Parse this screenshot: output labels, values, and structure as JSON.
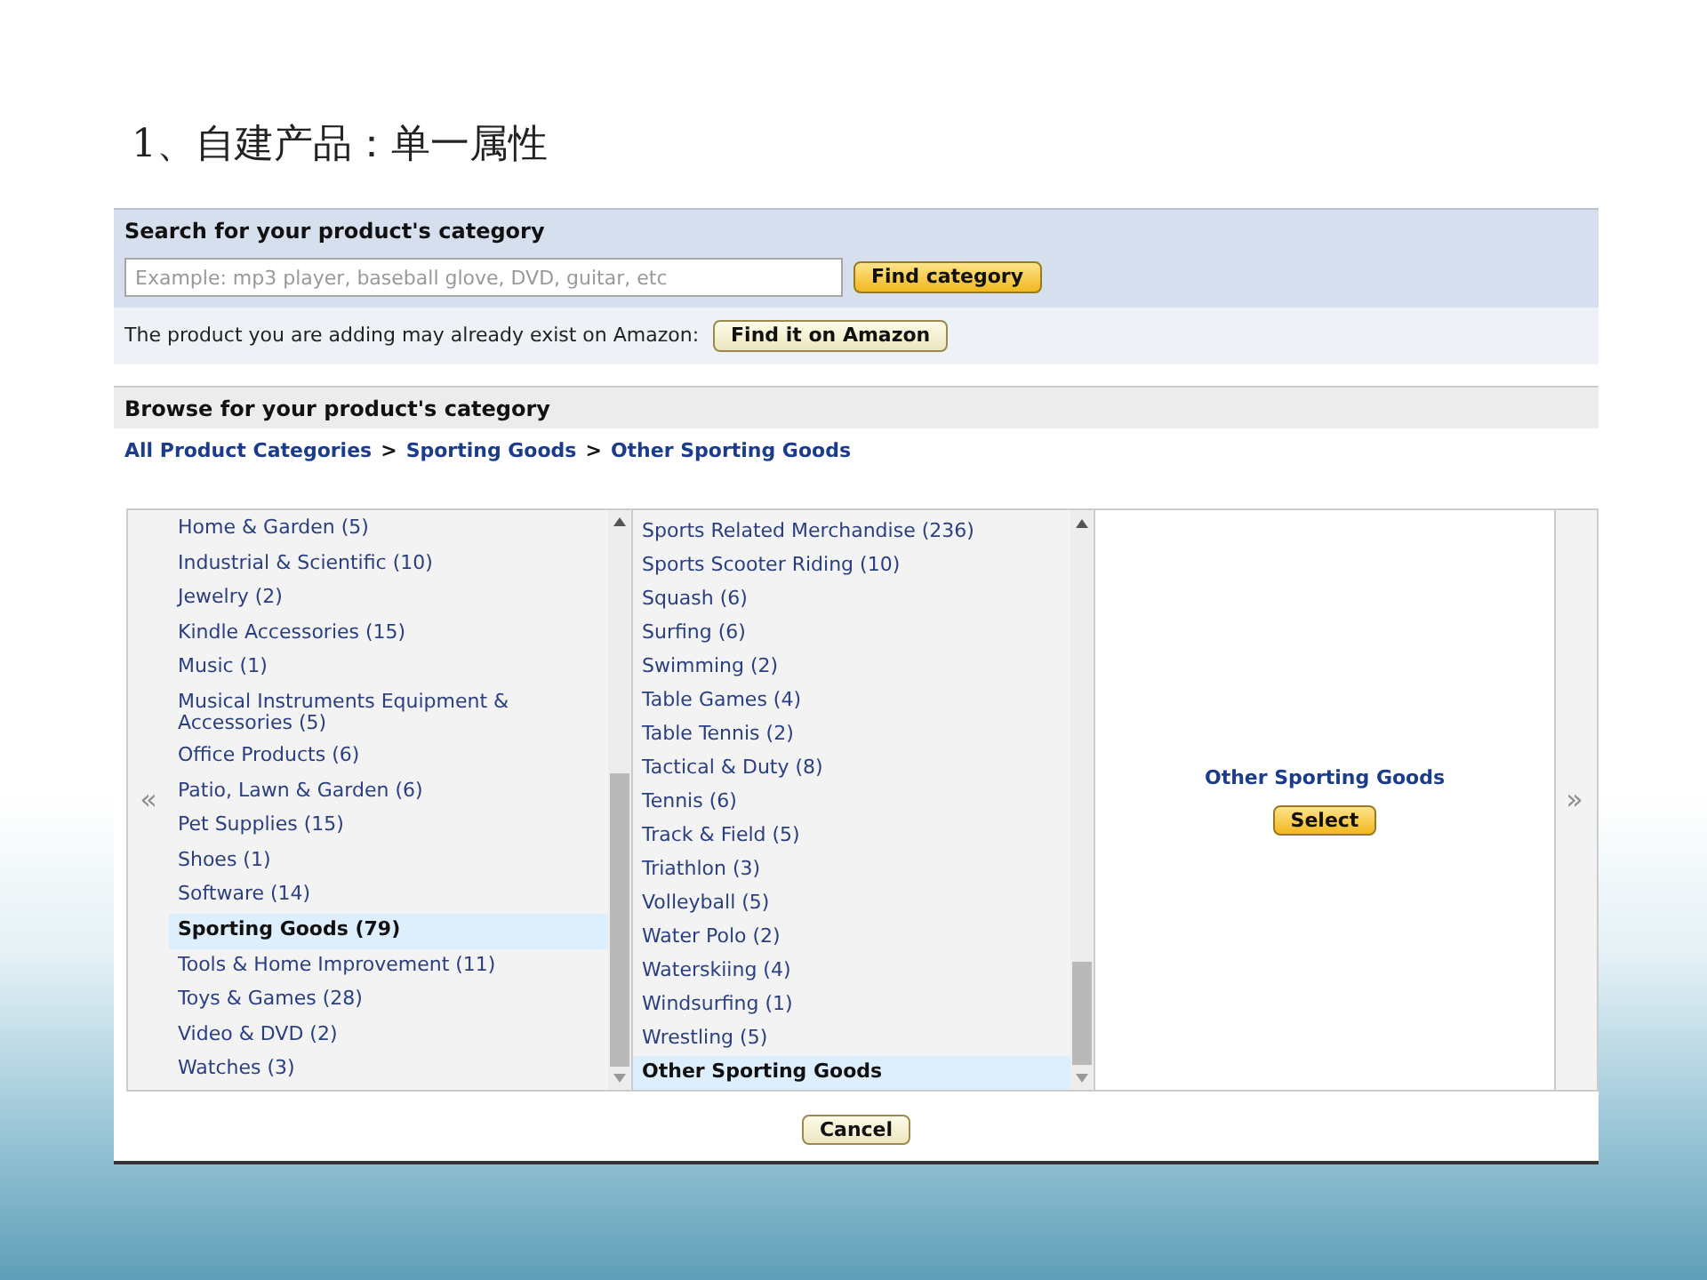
{
  "slide_title": "1、自建产品：单一属性",
  "search": {
    "heading": "Search for your product's category",
    "placeholder": "Example: mp3 player, baseball glove, DVD, guitar, etc",
    "button": "Find category"
  },
  "exists": {
    "text": "The product you are adding may already exist on Amazon:",
    "button": "Find it on Amazon"
  },
  "browse": {
    "heading": "Browse for your product's category",
    "breadcrumb": [
      {
        "kind": "link",
        "text": "All Product Categories"
      },
      {
        "kind": "separator",
        "text": ">"
      },
      {
        "kind": "link",
        "text": "Sporting Goods"
      },
      {
        "kind": "separator",
        "text": ">"
      },
      {
        "kind": "link",
        "text": "Other Sporting Goods"
      }
    ],
    "prev": "«",
    "next": "»",
    "columns": [
      {
        "items": [
          {
            "label": "Home & Garden (5)",
            "selected": false
          },
          {
            "label": "Industrial & Scientific (10)",
            "selected": false
          },
          {
            "label": "Jewelry (2)",
            "selected": false
          },
          {
            "label": "Kindle Accessories (15)",
            "selected": false
          },
          {
            "label": "Music (1)",
            "selected": false
          },
          {
            "label": "Musical Instruments Equipment & Accessories (5)",
            "selected": false
          },
          {
            "label": "Office Products (6)",
            "selected": false
          },
          {
            "label": "Patio, Lawn & Garden (6)",
            "selected": false
          },
          {
            "label": "Pet Supplies (15)",
            "selected": false
          },
          {
            "label": "Shoes (1)",
            "selected": false
          },
          {
            "label": "Software (14)",
            "selected": false
          },
          {
            "label": "Sporting Goods (79)",
            "selected": true
          },
          {
            "label": "Tools & Home Improvement (11)",
            "selected": false
          },
          {
            "label": "Toys & Games (28)",
            "selected": false
          },
          {
            "label": "Video & DVD (2)",
            "selected": false
          },
          {
            "label": "Watches (3)",
            "selected": false
          }
        ]
      },
      {
        "items": [
          {
            "label": "Sports Related Merchandise (236)",
            "selected": false
          },
          {
            "label": "Sports Scooter Riding (10)",
            "selected": false
          },
          {
            "label": "Squash (6)",
            "selected": false
          },
          {
            "label": "Surfing (6)",
            "selected": false
          },
          {
            "label": "Swimming (2)",
            "selected": false
          },
          {
            "label": "Table Games (4)",
            "selected": false
          },
          {
            "label": "Table Tennis (2)",
            "selected": false
          },
          {
            "label": "Tactical & Duty (8)",
            "selected": false
          },
          {
            "label": "Tennis (6)",
            "selected": false
          },
          {
            "label": "Track & Field (5)",
            "selected": false
          },
          {
            "label": "Triathlon (3)",
            "selected": false
          },
          {
            "label": "Volleyball (5)",
            "selected": false
          },
          {
            "label": "Water Polo (2)",
            "selected": false
          },
          {
            "label": "Waterskiing (4)",
            "selected": false
          },
          {
            "label": "Windsurfing (1)",
            "selected": false
          },
          {
            "label": "Wrestling (5)",
            "selected": false
          },
          {
            "label": "Other Sporting Goods",
            "selected": true
          }
        ]
      }
    ],
    "detail": {
      "title": "Other Sporting Goods",
      "button": "Select"
    }
  },
  "cancel": "Cancel"
}
